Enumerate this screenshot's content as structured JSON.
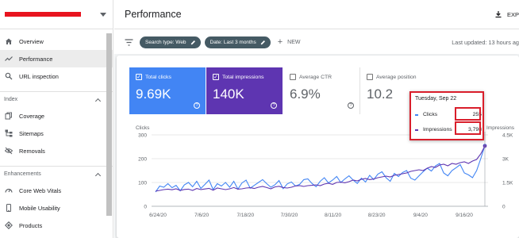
{
  "sidebar": {
    "items_top": [
      {
        "label": "Overview",
        "icon": "home-icon"
      },
      {
        "label": "Performance",
        "icon": "trending-icon",
        "active": true
      },
      {
        "label": "URL inspection",
        "icon": "search-icon"
      }
    ],
    "index_section": "Index",
    "index_items": [
      {
        "label": "Coverage",
        "icon": "copy-icon"
      },
      {
        "label": "Sitemaps",
        "icon": "sitemap-icon"
      },
      {
        "label": "Removals",
        "icon": "eye-off-icon"
      }
    ],
    "enh_section": "Enhancements",
    "enh_items": [
      {
        "label": "Core Web Vitals",
        "icon": "gauge-icon"
      },
      {
        "label": "Mobile Usability",
        "icon": "phone-icon"
      },
      {
        "label": "Products",
        "icon": "diamond-icon"
      }
    ]
  },
  "header": {
    "title": "Performance",
    "export_label": "EXP"
  },
  "filters": {
    "chip1": "Search type: Web",
    "chip2": "Date: Last 3 months",
    "new_label": "NEW",
    "last_updated": "Last updated: 13 hours ag"
  },
  "metrics": {
    "clicks": {
      "label": "Total clicks",
      "value": "9.69K"
    },
    "impressions": {
      "label": "Total impressions",
      "value": "140K"
    },
    "ctr": {
      "label": "Average CTR",
      "value": "6.9%"
    },
    "position": {
      "label": "Average position",
      "value": "10.2"
    }
  },
  "colors": {
    "clicks": "#4285f4",
    "impressions": "#5e35b1"
  },
  "tooltip": {
    "date": "Tuesday, Sep 22",
    "clicks_label": "Clicks",
    "clicks_value": "255",
    "impr_label": "Impressions",
    "impr_value": "3,798"
  },
  "chart_data": {
    "type": "line",
    "ylabel_left": "Clicks",
    "ylabel_right": "Impressions",
    "left_ticks": [
      "300",
      "200",
      "100",
      "0"
    ],
    "right_ticks": [
      "4.5K",
      "3K",
      "1.5K",
      "0"
    ],
    "ylim_left": [
      0,
      300
    ],
    "ylim_right": [
      0,
      4500
    ],
    "x_ticks": [
      "6/24/20",
      "7/6/20",
      "7/18/20",
      "7/30/20",
      "8/11/20",
      "8/23/20",
      "9/4/20",
      "9/16/20"
    ],
    "series": [
      {
        "name": "Clicks",
        "axis": "left",
        "values": [
          60,
          85,
          80,
          95,
          78,
          88,
          65,
          90,
          100,
          82,
          105,
          75,
          92,
          110,
          70,
          95,
          85,
          100,
          80,
          105,
          72,
          98,
          110,
          76,
          88,
          100,
          112,
          95,
          80,
          90,
          108,
          74,
          94,
          102,
          85,
          92,
          112,
          115,
          96,
          82,
          105,
          120,
          98,
          110,
          125,
          100,
          115,
          128,
          110,
          96,
          118,
          102,
          130,
          112,
          135,
          145,
          120,
          105,
          138,
          125,
          142,
          150,
          118,
          110,
          128,
          145,
          160,
          148,
          170,
          180,
          140,
          128,
          150,
          162,
          175,
          140,
          132,
          120,
          150,
          200,
          255
        ]
      },
      {
        "name": "Impressions",
        "axis": "right",
        "values": [
          950,
          1000,
          1050,
          1080,
          1040,
          1100,
          1000,
          1060,
          1080,
          1000,
          1120,
          1050,
          1090,
          1130,
          1010,
          1150,
          1100,
          1050,
          1100,
          1180,
          1080,
          1100,
          1150,
          1170,
          1120,
          1200,
          1250,
          1180,
          1100,
          1220,
          1260,
          1180,
          1150,
          1200,
          1280,
          1300,
          1250,
          1300,
          1320,
          1350,
          1300,
          1400,
          1450,
          1380,
          1500,
          1520,
          1480,
          1550,
          1650,
          1600,
          1700,
          1750,
          1680,
          1720,
          1800,
          1850,
          1900,
          1850,
          1950,
          2000,
          2050,
          2100,
          2200,
          2250,
          2300,
          2250,
          2400,
          2500,
          2450,
          2600,
          2650,
          2550,
          2700,
          2650,
          2750,
          2800,
          2700,
          2850,
          2950,
          3300,
          3798
        ]
      }
    ]
  }
}
